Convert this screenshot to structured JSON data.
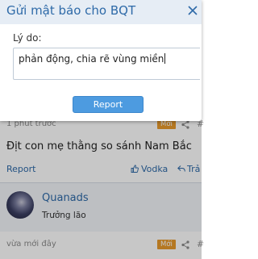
{
  "modal": {
    "title": "Gửi mật báo cho BQT",
    "reason_label": "Lý do:",
    "reason_value": "phản động, chia rẽ vùng miền",
    "submit_label": "Report"
  },
  "post": {
    "time": "1 phút trước",
    "badge": "Mới",
    "hash": "#",
    "body": "Địt con mẹ thằng so sánh Nam Bắc",
    "report_label": "Report",
    "like_label": "Vodka",
    "reply_label": "Trả"
  },
  "user": {
    "name": "Quanads",
    "title": "Trưởng lão"
  },
  "next_post": {
    "time": "vừa mới đây",
    "badge": "Mới",
    "hash": "#"
  },
  "colors": {
    "link": "#2e6aa8",
    "badge": "#e89a2c",
    "button": "#4d9be0"
  }
}
